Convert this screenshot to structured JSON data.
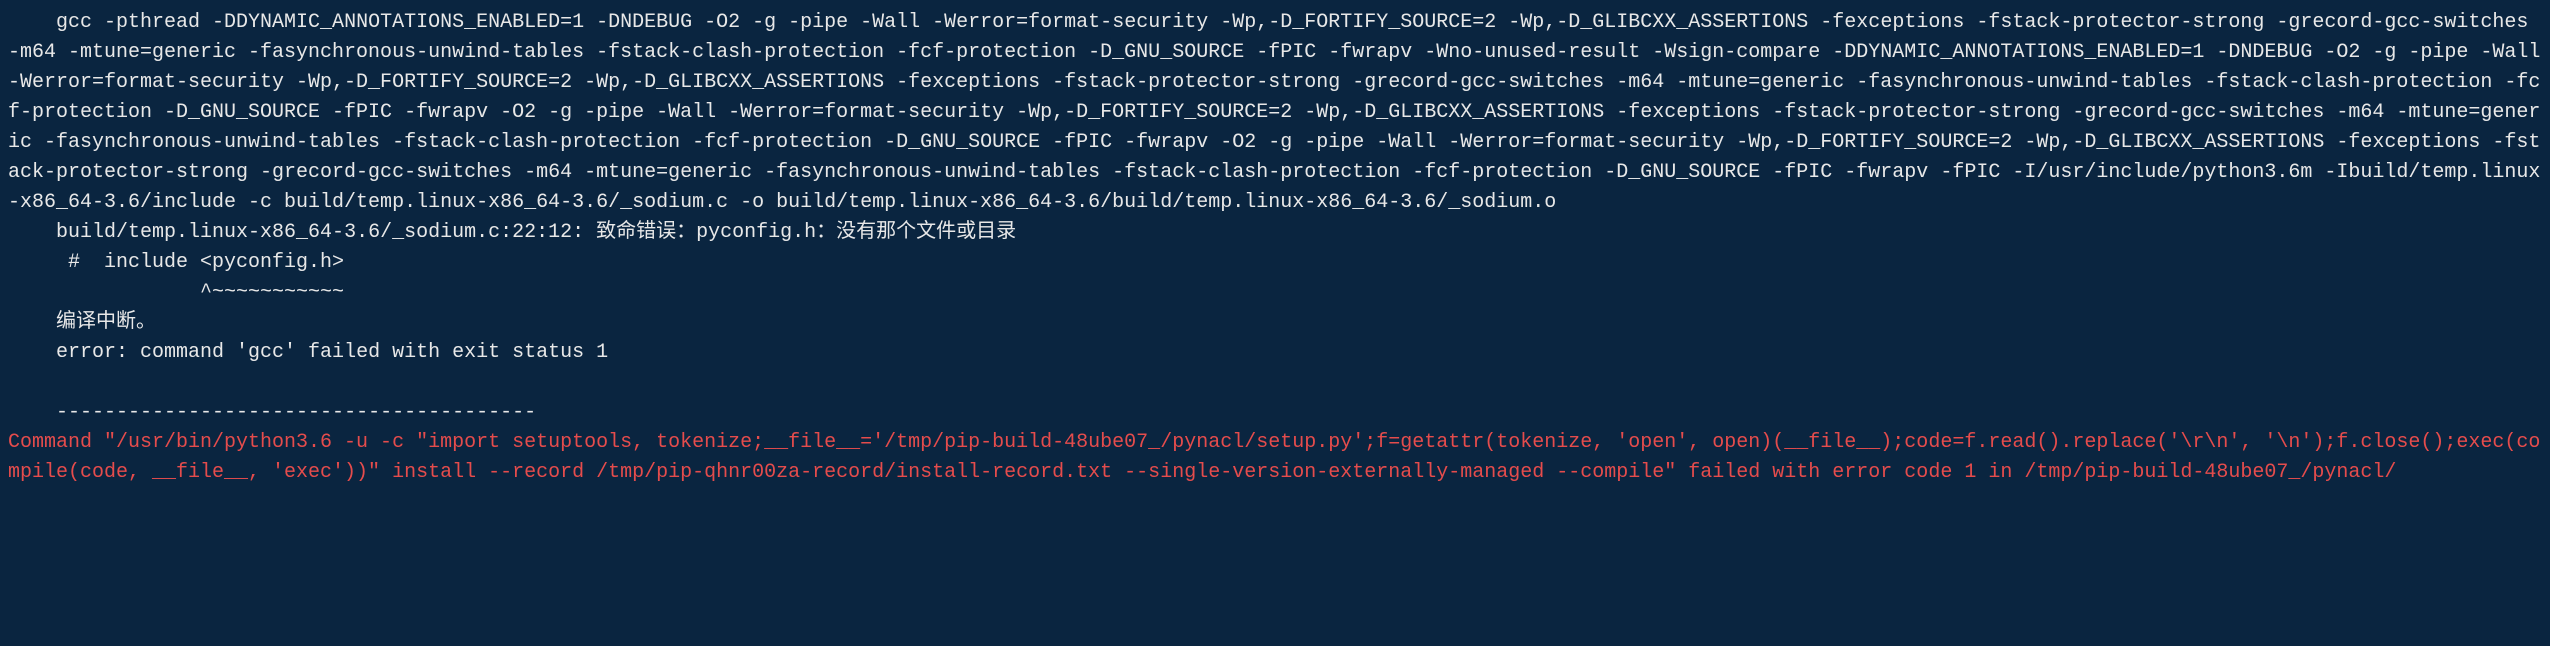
{
  "terminal": {
    "gcc_command": "    gcc -pthread -DDYNAMIC_ANNOTATIONS_ENABLED=1 -DNDEBUG -O2 -g -pipe -Wall -Werror=format-security -Wp,-D_FORTIFY_SOURCE=2 -Wp,-D_GLIBCXX_ASSERTIONS -fexceptions -fstack-protector-strong -grecord-gcc-switches -m64 -mtune=generic -fasynchronous-unwind-tables -fstack-clash-protection -fcf-protection -D_GNU_SOURCE -fPIC -fwrapv -Wno-unused-result -Wsign-compare -DDYNAMIC_ANNOTATIONS_ENABLED=1 -DNDEBUG -O2 -g -pipe -Wall -Werror=format-security -Wp,-D_FORTIFY_SOURCE=2 -Wp,-D_GLIBCXX_ASSERTIONS -fexceptions -fstack-protector-strong -grecord-gcc-switches -m64 -mtune=generic -fasynchronous-unwind-tables -fstack-clash-protection -fcf-protection -D_GNU_SOURCE -fPIC -fwrapv -O2 -g -pipe -Wall -Werror=format-security -Wp,-D_FORTIFY_SOURCE=2 -Wp,-D_GLIBCXX_ASSERTIONS -fexceptions -fstack-protector-strong -grecord-gcc-switches -m64 -mtune=generic -fasynchronous-unwind-tables -fstack-clash-protection -fcf-protection -D_GNU_SOURCE -fPIC -fwrapv -O2 -g -pipe -Wall -Werror=format-security -Wp,-D_FORTIFY_SOURCE=2 -Wp,-D_GLIBCXX_ASSERTIONS -fexceptions -fstack-protector-strong -grecord-gcc-switches -m64 -mtune=generic -fasynchronous-unwind-tables -fstack-clash-protection -fcf-protection -D_GNU_SOURCE -fPIC -fwrapv -fPIC -I/usr/include/python3.6m -Ibuild/temp.linux-x86_64-3.6/include -c build/temp.linux-x86_64-3.6/_sodium.c -o build/temp.linux-x86_64-3.6/build/temp.linux-x86_64-3.6/_sodium.o",
    "fatal_error": "    build/temp.linux-x86_64-3.6/_sodium.c:22:12: 致命错误：pyconfig.h：没有那个文件或目录",
    "include_line": "     #  include <pyconfig.h>",
    "caret_line": "                ^~~~~~~~~~~~",
    "compile_abort": "    编译中断。",
    "gcc_failed": "    error: command 'gcc' failed with exit status 1",
    "blank_line": "    ",
    "separator": "    ----------------------------------------",
    "command_error": "Command \"/usr/bin/python3.6 -u -c \"import setuptools, tokenize;__file__='/tmp/pip-build-48ube07_/pynacl/setup.py';f=getattr(tokenize, 'open', open)(__file__);code=f.read().replace('\\r\\n', '\\n');f.close();exec(compile(code, __file__, 'exec'))\" install --record /tmp/pip-qhnr00za-record/install-record.txt --single-version-externally-managed --compile\" failed with error code 1 in /tmp/pip-build-48ube07_/pynacl/"
  }
}
